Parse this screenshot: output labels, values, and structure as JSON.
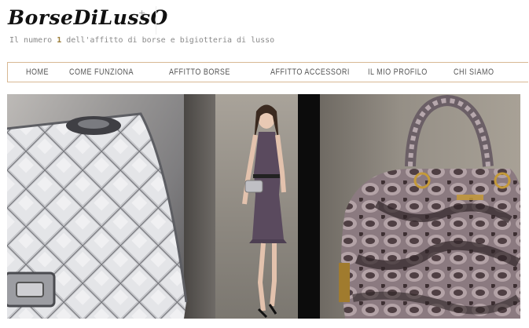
{
  "header": {
    "logo_text": "BorseDiLussO",
    "logo_sparkle": "+",
    "tagline_pre": "Il numero ",
    "tagline_hl": "1",
    "tagline_post": " dell'affitto di borse e bigiotteria di lusso"
  },
  "nav": {
    "items": [
      {
        "label": "HOME"
      },
      {
        "label": "COME FUNZIONA"
      },
      {
        "label": "AFFITTO BORSE"
      },
      {
        "label": "AFFITTO ACCESSORI"
      },
      {
        "label": "IL MIO PROFILO"
      },
      {
        "label": "CHI SIAMO"
      }
    ]
  },
  "colors": {
    "nav_border": "#d8b894",
    "tagline_accent": "#9a7b35",
    "nav_text": "#555555"
  }
}
